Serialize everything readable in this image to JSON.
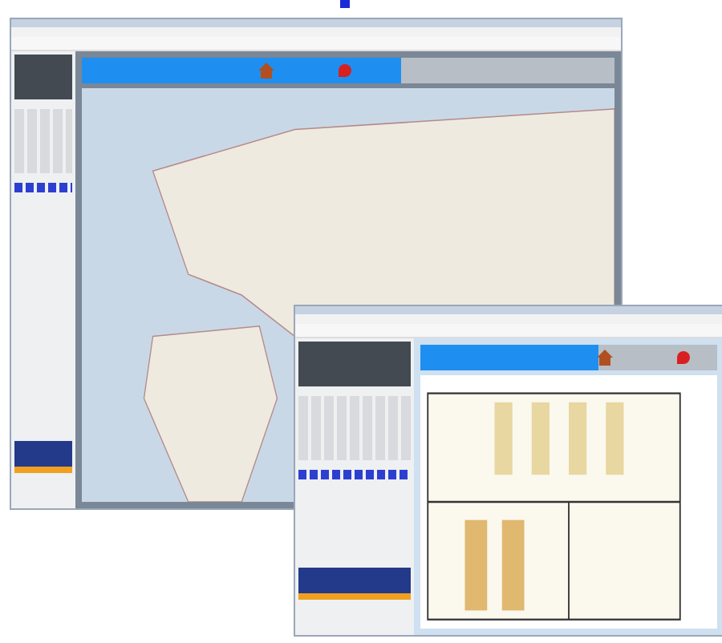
{
  "windows": [
    {
      "kind": "map"
    },
    {
      "kind": "floorplan"
    }
  ]
}
